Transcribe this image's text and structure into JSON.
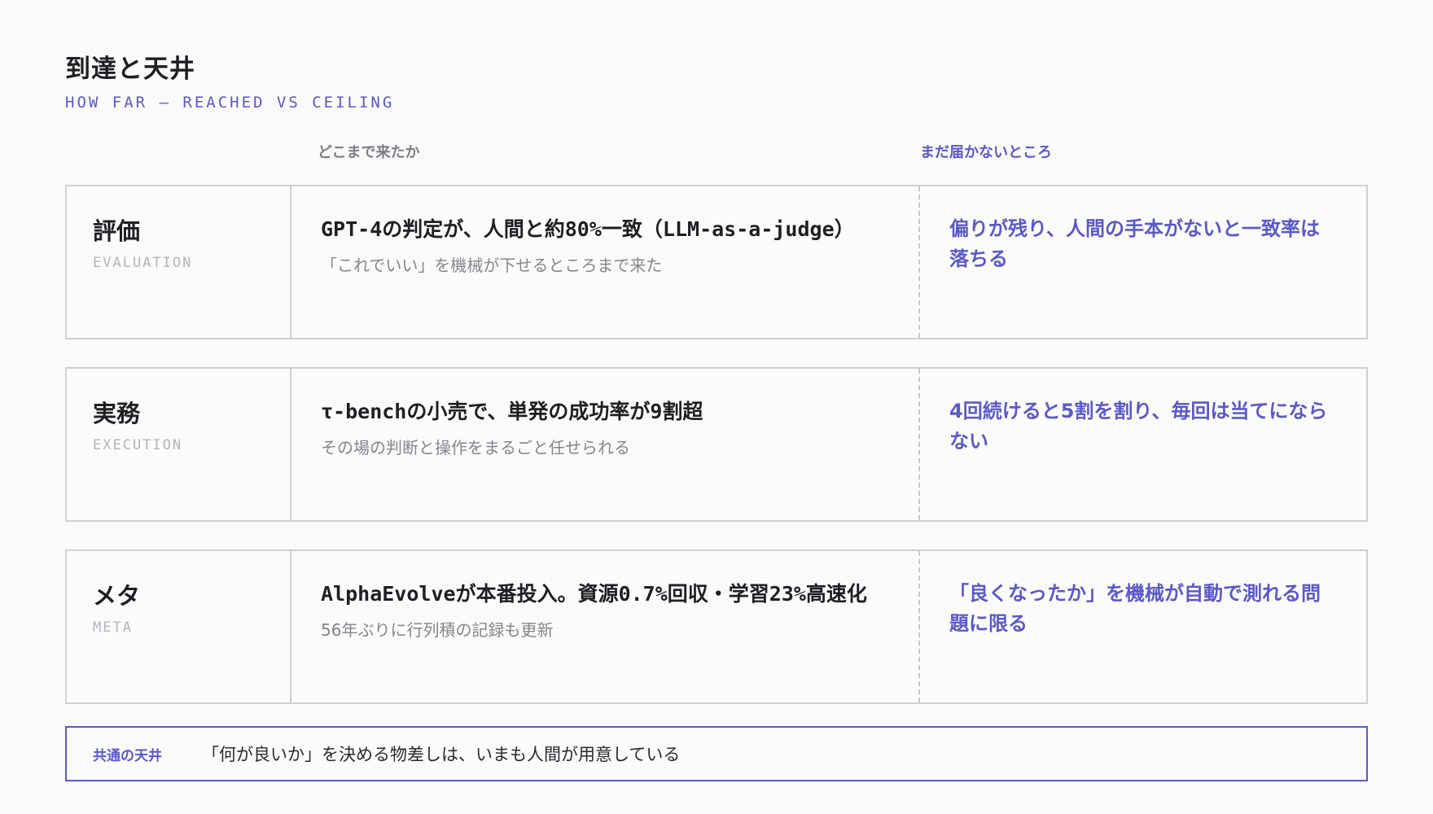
{
  "header": {
    "title": "到達と天井",
    "subtitle": "HOW FAR — REACHED VS CEILING"
  },
  "columns": {
    "reached": "どこまで来たか",
    "ceiling": "まだ届かないところ"
  },
  "rows": [
    {
      "label_jp": "評価",
      "label_en": "EVALUATION",
      "reached_main": "GPT-4の判定が、人間と約80%一致（LLM-as-a-judge）",
      "reached_sub": "「これでいい」を機械が下せるところまで来た",
      "ceiling": "偏りが残り、人間の手本がないと一致率は落ちる"
    },
    {
      "label_jp": "実務",
      "label_en": "EXECUTION",
      "reached_main": "τ-benchの小売で、単発の成功率が9割超",
      "reached_sub": "その場の判断と操作をまるごと任せられる",
      "ceiling": "4回続けると5割を割り、毎回は当てにならない"
    },
    {
      "label_jp": "メタ",
      "label_en": "META",
      "reached_main": "AlphaEvolveが本番投入。資源0.7%回収・学習23%高速化",
      "reached_sub": "56年ぶりに行列積の記録も更新",
      "ceiling": "「良くなったか」を機械が自動で測れる問題に限る"
    }
  ],
  "footer": {
    "label": "共通の天井",
    "text": "「何が良いか」を決める物差しは、いまも人間が用意している"
  }
}
